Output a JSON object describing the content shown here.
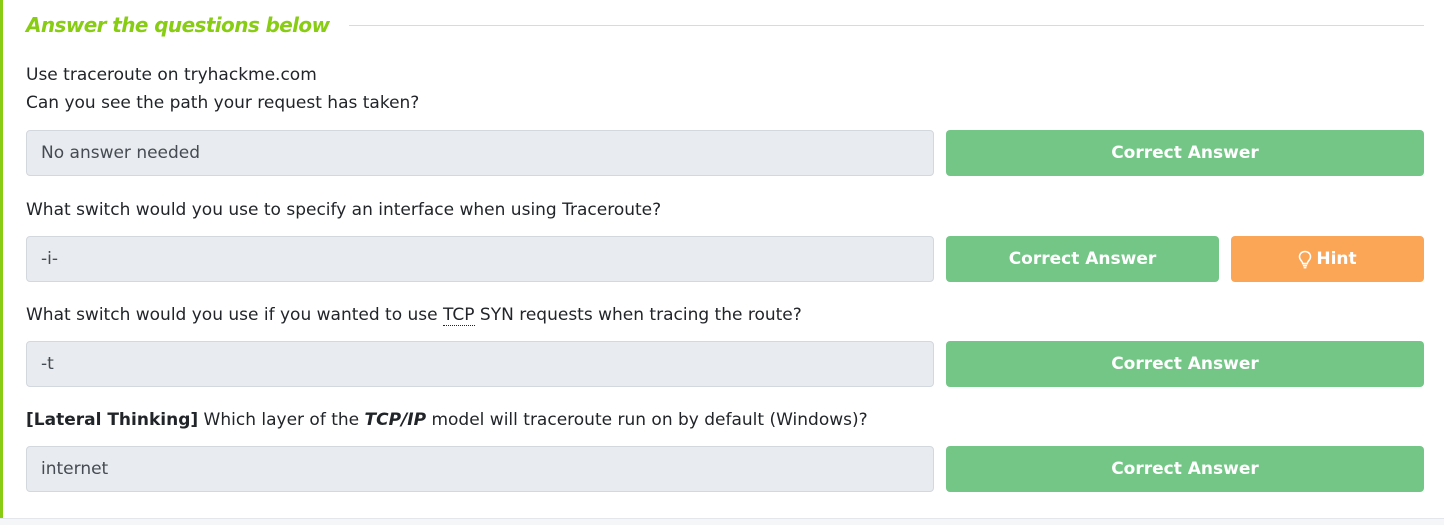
{
  "heading": "Answer the questions below",
  "questions": [
    {
      "line1": "Use traceroute on tryhackme.com",
      "line2": "Can you see the path your request has taken?",
      "answer": "No answer needed",
      "submit_label": "Correct Answer"
    },
    {
      "text": "What switch would you use to specify an interface when using Traceroute?",
      "answer": "-i-",
      "submit_label": "Correct Answer",
      "hint_label": "Hint",
      "hint_icon": "lightbulb-icon"
    },
    {
      "text_before": "What switch would you use if you wanted to use ",
      "abbr": "TCP",
      "text_after": " SYN requests when tracing the route?",
      "answer": "-t",
      "submit_label": "Correct Answer"
    },
    {
      "prefix": "[Lateral Thinking]",
      "text_before": " Which layer of the ",
      "emphasis": "TCP/IP",
      "text_after": " model will traceroute run on by default (Windows)?",
      "answer": "internet",
      "submit_label": "Correct Answer"
    }
  ],
  "colors": {
    "accent": "#88cc14",
    "correct_button": "#74c686",
    "hint_button": "#fba556",
    "answer_field_bg": "#e8ebef"
  }
}
